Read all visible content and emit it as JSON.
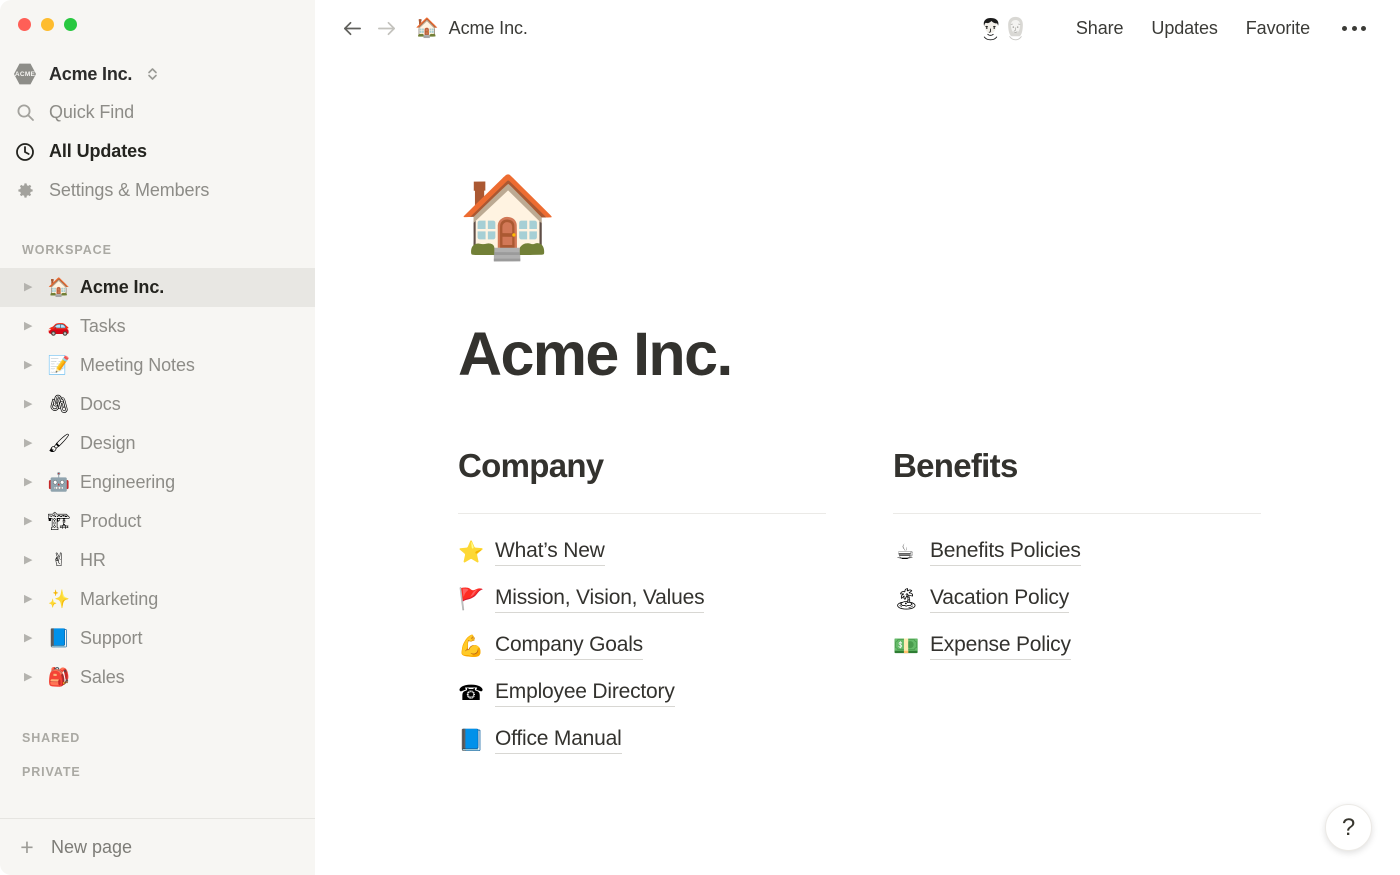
{
  "window": {
    "controls": [
      "close",
      "minimize",
      "maximize"
    ]
  },
  "sidebar": {
    "workspace": {
      "name": "Acme Inc.",
      "badge_text": "ACME"
    },
    "nav": [
      {
        "label": "Quick Find",
        "icon": "search-icon",
        "active": false
      },
      {
        "label": "All Updates",
        "icon": "clock-icon",
        "active": true
      },
      {
        "label": "Settings & Members",
        "icon": "gear-icon",
        "active": false
      }
    ],
    "sections": {
      "workspace_header": "WORKSPACE",
      "shared_header": "SHARED",
      "private_header": "PRIVATE"
    },
    "pages": [
      {
        "label": "Acme Inc.",
        "emoji": "🏠",
        "selected": true
      },
      {
        "label": "Tasks",
        "emoji": "🚗",
        "selected": false
      },
      {
        "label": "Meeting Notes",
        "emoji": "📝",
        "selected": false
      },
      {
        "label": "Docs",
        "emoji": "🖇",
        "selected": false
      },
      {
        "label": "Design",
        "emoji": "🖌",
        "selected": false
      },
      {
        "label": "Engineering",
        "emoji": "🤖",
        "selected": false
      },
      {
        "label": "Product",
        "emoji": "🏗",
        "selected": false
      },
      {
        "label": "HR",
        "emoji": "✌",
        "selected": false
      },
      {
        "label": "Marketing",
        "emoji": "✨",
        "selected": false
      },
      {
        "label": "Support",
        "emoji": "📘",
        "selected": false
      },
      {
        "label": "Sales",
        "emoji": "🎒",
        "selected": false
      }
    ],
    "footer": {
      "label": "New page",
      "icon": "plus-icon"
    }
  },
  "topbar": {
    "back_icon": "arrow-left-icon",
    "forward_icon": "arrow-right-icon",
    "breadcrumb": {
      "emoji": "🏠",
      "label": "Acme Inc."
    },
    "actions": [
      {
        "label": "Share"
      },
      {
        "label": "Updates"
      },
      {
        "label": "Favorite"
      }
    ],
    "more_icon": "ellipsis-icon",
    "avatar_count": 2
  },
  "page": {
    "emoji": "🏠",
    "title": "Acme Inc.",
    "columns": [
      {
        "heading": "Company",
        "links": [
          {
            "emoji": "⭐",
            "label": "What’s New"
          },
          {
            "emoji": "🚩",
            "label": "Mission, Vision, Values"
          },
          {
            "emoji": "💪",
            "label": "Company Goals"
          },
          {
            "emoji": "☎",
            "label": "Employee Directory"
          },
          {
            "emoji": "📘",
            "label": "Office Manual"
          }
        ]
      },
      {
        "heading": "Benefits",
        "links": [
          {
            "emoji": "☕",
            "label": "Benefits Policies"
          },
          {
            "emoji": "🏝",
            "label": "Vacation Policy"
          },
          {
            "emoji": "💵",
            "label": "Expense Policy"
          }
        ]
      }
    ]
  },
  "help_button": {
    "label": "?"
  },
  "colors": {
    "sidebar_bg": "#f7f6f3",
    "main_bg": "#ffffff",
    "selected_row": "#e8e7e3",
    "text_primary": "#33322e",
    "text_muted": "#8d8c87",
    "rule": "#ebeae7",
    "traffic_red": "#ff5f57",
    "traffic_amber": "#febc2e",
    "traffic_green": "#28c840"
  }
}
